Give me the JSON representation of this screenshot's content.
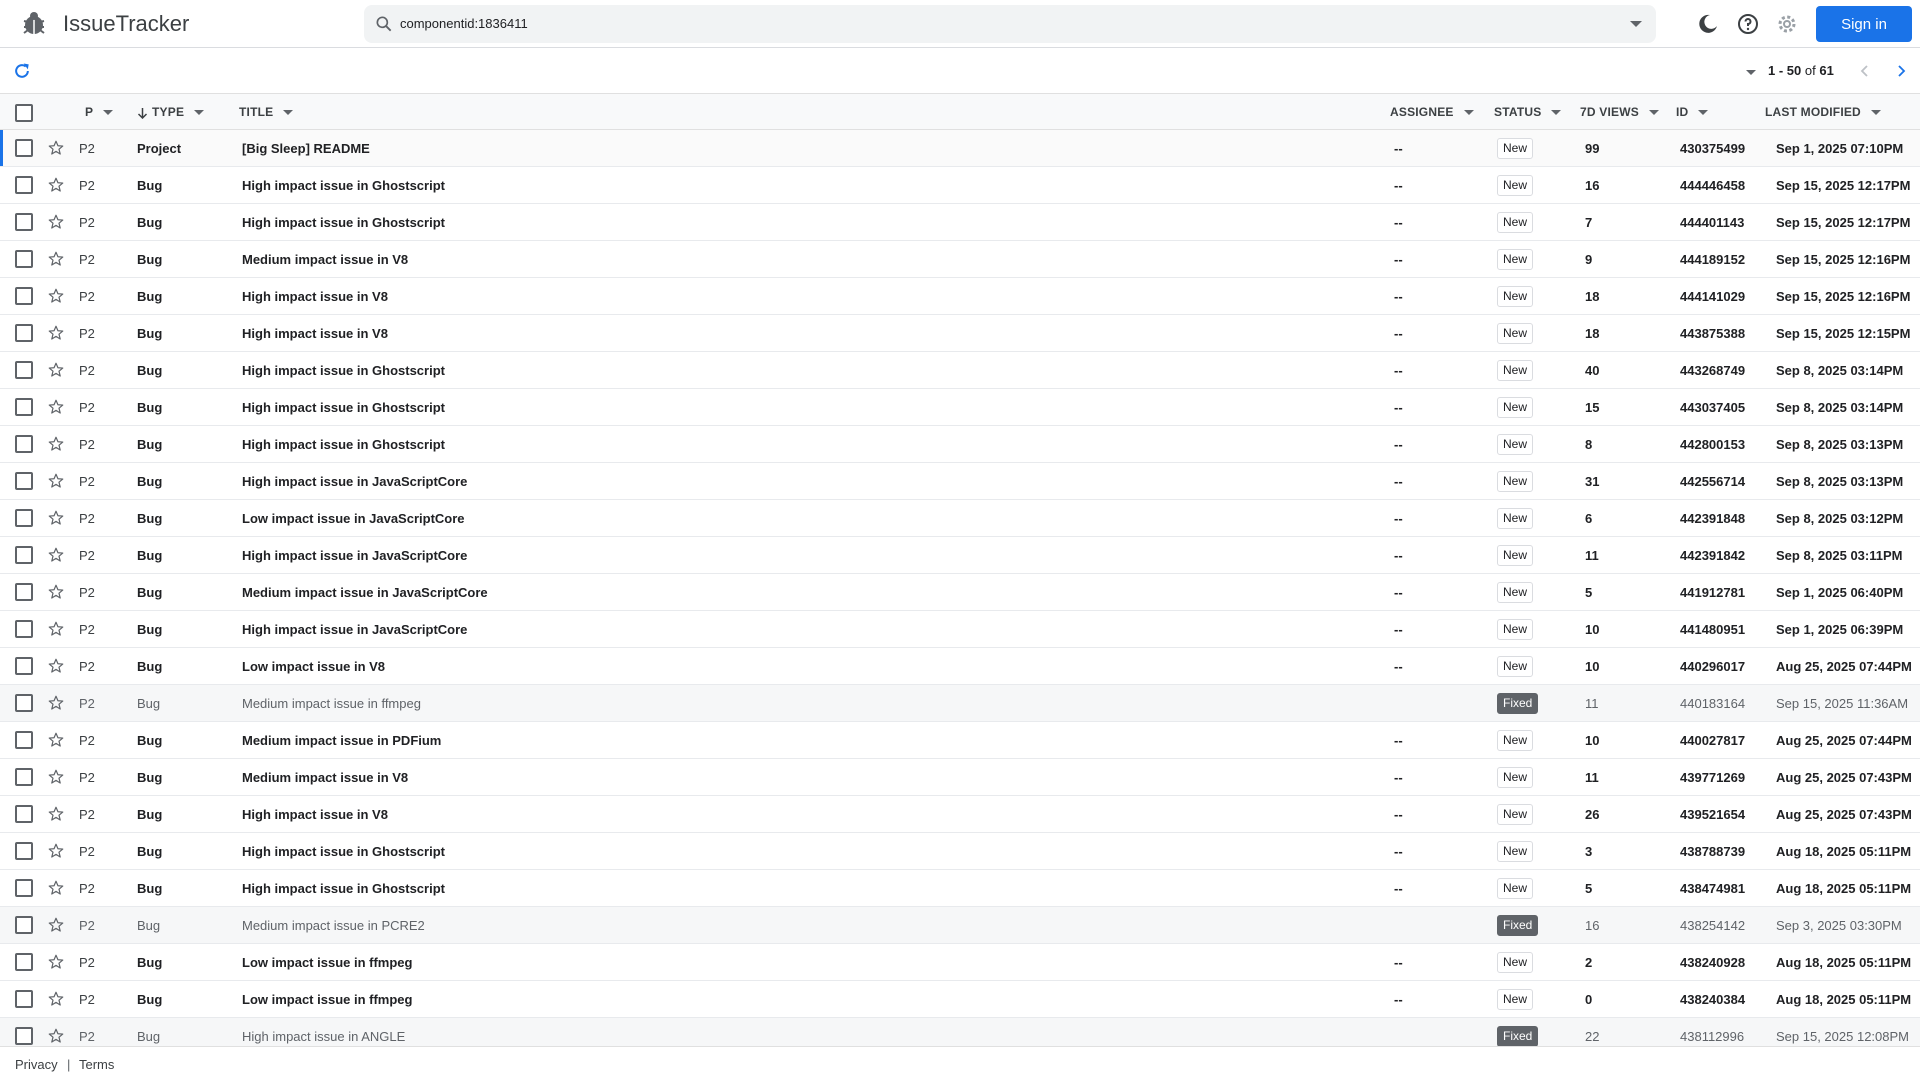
{
  "header": {
    "app_title": "IssueTracker",
    "search_query": "componentid:1836411",
    "signin_label": "Sign in",
    "accent_color": "#1a73e8"
  },
  "toolbar": {
    "paging_range": "1 - 50",
    "paging_of": "of",
    "paging_total": "61"
  },
  "columns": {
    "p": "P",
    "type": "TYPE",
    "title": "TITLE",
    "assignee": "ASSIGNEE",
    "status": "STATUS",
    "views": "7D VIEWS",
    "id": "ID",
    "modified": "LAST MODIFIED"
  },
  "rows": [
    {
      "p": "P2",
      "type": "Project",
      "title": "[Big Sleep] README",
      "assignee": "--",
      "status": "New",
      "views": "99",
      "id": "430375499",
      "modified": "Sep 1, 2025 07:10PM"
    },
    {
      "p": "P2",
      "type": "Bug",
      "title": "High impact issue in Ghostscript",
      "assignee": "--",
      "status": "New",
      "views": "16",
      "id": "444446458",
      "modified": "Sep 15, 2025 12:17PM"
    },
    {
      "p": "P2",
      "type": "Bug",
      "title": "High impact issue in Ghostscript",
      "assignee": "--",
      "status": "New",
      "views": "7",
      "id": "444401143",
      "modified": "Sep 15, 2025 12:17PM"
    },
    {
      "p": "P2",
      "type": "Bug",
      "title": "Medium impact issue in V8",
      "assignee": "--",
      "status": "New",
      "views": "9",
      "id": "444189152",
      "modified": "Sep 15, 2025 12:16PM"
    },
    {
      "p": "P2",
      "type": "Bug",
      "title": "High impact issue in V8",
      "assignee": "--",
      "status": "New",
      "views": "18",
      "id": "444141029",
      "modified": "Sep 15, 2025 12:16PM"
    },
    {
      "p": "P2",
      "type": "Bug",
      "title": "High impact issue in V8",
      "assignee": "--",
      "status": "New",
      "views": "18",
      "id": "443875388",
      "modified": "Sep 15, 2025 12:15PM"
    },
    {
      "p": "P2",
      "type": "Bug",
      "title": "High impact issue in Ghostscript",
      "assignee": "--",
      "status": "New",
      "views": "40",
      "id": "443268749",
      "modified": "Sep 8, 2025 03:14PM"
    },
    {
      "p": "P2",
      "type": "Bug",
      "title": "High impact issue in Ghostscript",
      "assignee": "--",
      "status": "New",
      "views": "15",
      "id": "443037405",
      "modified": "Sep 8, 2025 03:14PM"
    },
    {
      "p": "P2",
      "type": "Bug",
      "title": "High impact issue in Ghostscript",
      "assignee": "--",
      "status": "New",
      "views": "8",
      "id": "442800153",
      "modified": "Sep 8, 2025 03:13PM"
    },
    {
      "p": "P2",
      "type": "Bug",
      "title": "High impact issue in JavaScriptCore",
      "assignee": "--",
      "status": "New",
      "views": "31",
      "id": "442556714",
      "modified": "Sep 8, 2025 03:13PM"
    },
    {
      "p": "P2",
      "type": "Bug",
      "title": "Low impact issue in JavaScriptCore",
      "assignee": "--",
      "status": "New",
      "views": "6",
      "id": "442391848",
      "modified": "Sep 8, 2025 03:12PM"
    },
    {
      "p": "P2",
      "type": "Bug",
      "title": "High impact issue in JavaScriptCore",
      "assignee": "--",
      "status": "New",
      "views": "11",
      "id": "442391842",
      "modified": "Sep 8, 2025 03:11PM"
    },
    {
      "p": "P2",
      "type": "Bug",
      "title": "Medium impact issue in JavaScriptCore",
      "assignee": "--",
      "status": "New",
      "views": "5",
      "id": "441912781",
      "modified": "Sep 1, 2025 06:40PM"
    },
    {
      "p": "P2",
      "type": "Bug",
      "title": "High impact issue in JavaScriptCore",
      "assignee": "--",
      "status": "New",
      "views": "10",
      "id": "441480951",
      "modified": "Sep 1, 2025 06:39PM"
    },
    {
      "p": "P2",
      "type": "Bug",
      "title": "Low impact issue in V8",
      "assignee": "--",
      "status": "New",
      "views": "10",
      "id": "440296017",
      "modified": "Aug 25, 2025 07:44PM"
    },
    {
      "p": "P2",
      "type": "Bug",
      "title": "Medium impact issue in ffmpeg",
      "assignee": "",
      "status": "Fixed",
      "views": "11",
      "id": "440183164",
      "modified": "Sep 15, 2025 11:36AM"
    },
    {
      "p": "P2",
      "type": "Bug",
      "title": "Medium impact issue in PDFium",
      "assignee": "--",
      "status": "New",
      "views": "10",
      "id": "440027817",
      "modified": "Aug 25, 2025 07:44PM"
    },
    {
      "p": "P2",
      "type": "Bug",
      "title": "Medium impact issue in V8",
      "assignee": "--",
      "status": "New",
      "views": "11",
      "id": "439771269",
      "modified": "Aug 25, 2025 07:43PM"
    },
    {
      "p": "P2",
      "type": "Bug",
      "title": "High impact issue in V8",
      "assignee": "--",
      "status": "New",
      "views": "26",
      "id": "439521654",
      "modified": "Aug 25, 2025 07:43PM"
    },
    {
      "p": "P2",
      "type": "Bug",
      "title": "High impact issue in Ghostscript",
      "assignee": "--",
      "status": "New",
      "views": "3",
      "id": "438788739",
      "modified": "Aug 18, 2025 05:11PM"
    },
    {
      "p": "P2",
      "type": "Bug",
      "title": "High impact issue in Ghostscript",
      "assignee": "--",
      "status": "New",
      "views": "5",
      "id": "438474981",
      "modified": "Aug 18, 2025 05:11PM"
    },
    {
      "p": "P2",
      "type": "Bug",
      "title": "Medium impact issue in PCRE2",
      "assignee": "",
      "status": "Fixed",
      "views": "16",
      "id": "438254142",
      "modified": "Sep 3, 2025 03:30PM"
    },
    {
      "p": "P2",
      "type": "Bug",
      "title": "Low impact issue in ffmpeg",
      "assignee": "--",
      "status": "New",
      "views": "2",
      "id": "438240928",
      "modified": "Aug 18, 2025 05:11PM"
    },
    {
      "p": "P2",
      "type": "Bug",
      "title": "Low impact issue in ffmpeg",
      "assignee": "--",
      "status": "New",
      "views": "0",
      "id": "438240384",
      "modified": "Aug 18, 2025 05:11PM"
    },
    {
      "p": "P2",
      "type": "Bug",
      "title": "High impact issue in ANGLE",
      "assignee": "",
      "status": "Fixed",
      "views": "22",
      "id": "438112996",
      "modified": "Sep 15, 2025 12:08PM"
    }
  ],
  "footer": {
    "privacy": "Privacy",
    "separator": "|",
    "terms": "Terms"
  }
}
